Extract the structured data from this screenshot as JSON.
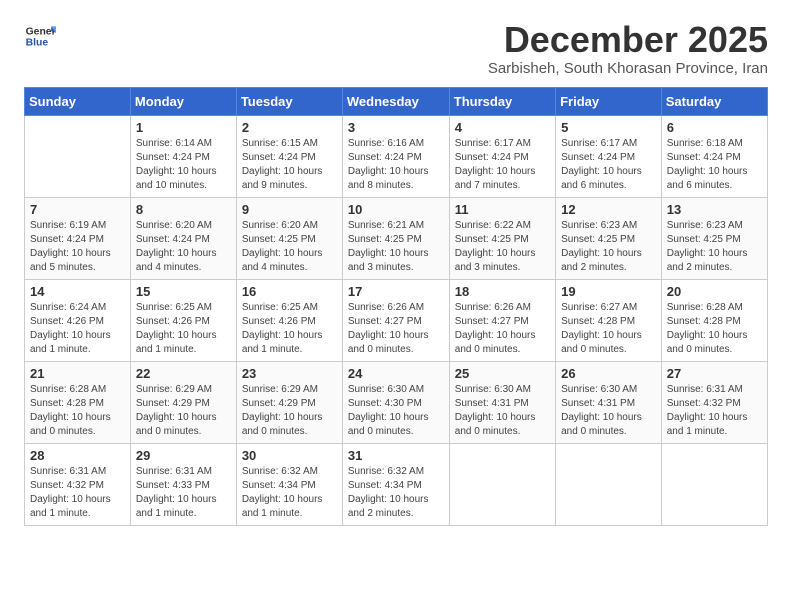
{
  "header": {
    "logo_general": "General",
    "logo_blue": "Blue",
    "month_title": "December 2025",
    "subtitle": "Sarbisheh, South Khorasan Province, Iran"
  },
  "weekdays": [
    "Sunday",
    "Monday",
    "Tuesday",
    "Wednesday",
    "Thursday",
    "Friday",
    "Saturday"
  ],
  "weeks": [
    [
      {
        "day": "",
        "sunrise": "",
        "sunset": "",
        "daylight": ""
      },
      {
        "day": "1",
        "sunrise": "Sunrise: 6:14 AM",
        "sunset": "Sunset: 4:24 PM",
        "daylight": "Daylight: 10 hours and 10 minutes."
      },
      {
        "day": "2",
        "sunrise": "Sunrise: 6:15 AM",
        "sunset": "Sunset: 4:24 PM",
        "daylight": "Daylight: 10 hours and 9 minutes."
      },
      {
        "day": "3",
        "sunrise": "Sunrise: 6:16 AM",
        "sunset": "Sunset: 4:24 PM",
        "daylight": "Daylight: 10 hours and 8 minutes."
      },
      {
        "day": "4",
        "sunrise": "Sunrise: 6:17 AM",
        "sunset": "Sunset: 4:24 PM",
        "daylight": "Daylight: 10 hours and 7 minutes."
      },
      {
        "day": "5",
        "sunrise": "Sunrise: 6:17 AM",
        "sunset": "Sunset: 4:24 PM",
        "daylight": "Daylight: 10 hours and 6 minutes."
      },
      {
        "day": "6",
        "sunrise": "Sunrise: 6:18 AM",
        "sunset": "Sunset: 4:24 PM",
        "daylight": "Daylight: 10 hours and 6 minutes."
      }
    ],
    [
      {
        "day": "7",
        "sunrise": "Sunrise: 6:19 AM",
        "sunset": "Sunset: 4:24 PM",
        "daylight": "Daylight: 10 hours and 5 minutes."
      },
      {
        "day": "8",
        "sunrise": "Sunrise: 6:20 AM",
        "sunset": "Sunset: 4:24 PM",
        "daylight": "Daylight: 10 hours and 4 minutes."
      },
      {
        "day": "9",
        "sunrise": "Sunrise: 6:20 AM",
        "sunset": "Sunset: 4:25 PM",
        "daylight": "Daylight: 10 hours and 4 minutes."
      },
      {
        "day": "10",
        "sunrise": "Sunrise: 6:21 AM",
        "sunset": "Sunset: 4:25 PM",
        "daylight": "Daylight: 10 hours and 3 minutes."
      },
      {
        "day": "11",
        "sunrise": "Sunrise: 6:22 AM",
        "sunset": "Sunset: 4:25 PM",
        "daylight": "Daylight: 10 hours and 3 minutes."
      },
      {
        "day": "12",
        "sunrise": "Sunrise: 6:23 AM",
        "sunset": "Sunset: 4:25 PM",
        "daylight": "Daylight: 10 hours and 2 minutes."
      },
      {
        "day": "13",
        "sunrise": "Sunrise: 6:23 AM",
        "sunset": "Sunset: 4:25 PM",
        "daylight": "Daylight: 10 hours and 2 minutes."
      }
    ],
    [
      {
        "day": "14",
        "sunrise": "Sunrise: 6:24 AM",
        "sunset": "Sunset: 4:26 PM",
        "daylight": "Daylight: 10 hours and 1 minute."
      },
      {
        "day": "15",
        "sunrise": "Sunrise: 6:25 AM",
        "sunset": "Sunset: 4:26 PM",
        "daylight": "Daylight: 10 hours and 1 minute."
      },
      {
        "day": "16",
        "sunrise": "Sunrise: 6:25 AM",
        "sunset": "Sunset: 4:26 PM",
        "daylight": "Daylight: 10 hours and 1 minute."
      },
      {
        "day": "17",
        "sunrise": "Sunrise: 6:26 AM",
        "sunset": "Sunset: 4:27 PM",
        "daylight": "Daylight: 10 hours and 0 minutes."
      },
      {
        "day": "18",
        "sunrise": "Sunrise: 6:26 AM",
        "sunset": "Sunset: 4:27 PM",
        "daylight": "Daylight: 10 hours and 0 minutes."
      },
      {
        "day": "19",
        "sunrise": "Sunrise: 6:27 AM",
        "sunset": "Sunset: 4:28 PM",
        "daylight": "Daylight: 10 hours and 0 minutes."
      },
      {
        "day": "20",
        "sunrise": "Sunrise: 6:28 AM",
        "sunset": "Sunset: 4:28 PM",
        "daylight": "Daylight: 10 hours and 0 minutes."
      }
    ],
    [
      {
        "day": "21",
        "sunrise": "Sunrise: 6:28 AM",
        "sunset": "Sunset: 4:28 PM",
        "daylight": "Daylight: 10 hours and 0 minutes."
      },
      {
        "day": "22",
        "sunrise": "Sunrise: 6:29 AM",
        "sunset": "Sunset: 4:29 PM",
        "daylight": "Daylight: 10 hours and 0 minutes."
      },
      {
        "day": "23",
        "sunrise": "Sunrise: 6:29 AM",
        "sunset": "Sunset: 4:29 PM",
        "daylight": "Daylight: 10 hours and 0 minutes."
      },
      {
        "day": "24",
        "sunrise": "Sunrise: 6:30 AM",
        "sunset": "Sunset: 4:30 PM",
        "daylight": "Daylight: 10 hours and 0 minutes."
      },
      {
        "day": "25",
        "sunrise": "Sunrise: 6:30 AM",
        "sunset": "Sunset: 4:31 PM",
        "daylight": "Daylight: 10 hours and 0 minutes."
      },
      {
        "day": "26",
        "sunrise": "Sunrise: 6:30 AM",
        "sunset": "Sunset: 4:31 PM",
        "daylight": "Daylight: 10 hours and 0 minutes."
      },
      {
        "day": "27",
        "sunrise": "Sunrise: 6:31 AM",
        "sunset": "Sunset: 4:32 PM",
        "daylight": "Daylight: 10 hours and 1 minute."
      }
    ],
    [
      {
        "day": "28",
        "sunrise": "Sunrise: 6:31 AM",
        "sunset": "Sunset: 4:32 PM",
        "daylight": "Daylight: 10 hours and 1 minute."
      },
      {
        "day": "29",
        "sunrise": "Sunrise: 6:31 AM",
        "sunset": "Sunset: 4:33 PM",
        "daylight": "Daylight: 10 hours and 1 minute."
      },
      {
        "day": "30",
        "sunrise": "Sunrise: 6:32 AM",
        "sunset": "Sunset: 4:34 PM",
        "daylight": "Daylight: 10 hours and 1 minute."
      },
      {
        "day": "31",
        "sunrise": "Sunrise: 6:32 AM",
        "sunset": "Sunset: 4:34 PM",
        "daylight": "Daylight: 10 hours and 2 minutes."
      },
      {
        "day": "",
        "sunrise": "",
        "sunset": "",
        "daylight": ""
      },
      {
        "day": "",
        "sunrise": "",
        "sunset": "",
        "daylight": ""
      },
      {
        "day": "",
        "sunrise": "",
        "sunset": "",
        "daylight": ""
      }
    ]
  ]
}
